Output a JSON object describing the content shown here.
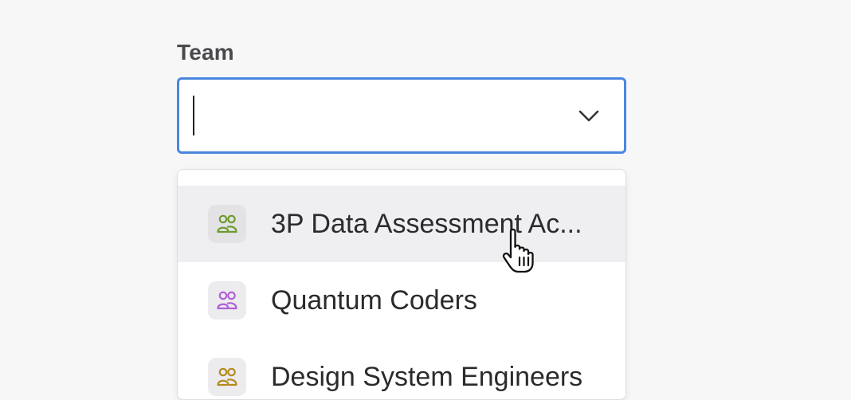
{
  "field": {
    "label": "Team",
    "value": "",
    "placeholder": ""
  },
  "dropdown": {
    "toggle_icon": "chevron-down-icon",
    "options": [
      {
        "label": "3P Data Assessment Ac...",
        "icon": "team-icon",
        "color": "#6e9a2c",
        "hovered": true
      },
      {
        "label": "Quantum Coders",
        "icon": "team-icon",
        "color": "#b25fd6",
        "hovered": false
      },
      {
        "label": "Design System Engineers",
        "icon": "team-icon",
        "color": "#b48a1c",
        "hovered": false
      }
    ]
  },
  "colors": {
    "focus_border": "#4a86e0",
    "hover_background": "#efeff1"
  },
  "cursor": "pointer-hand-icon"
}
